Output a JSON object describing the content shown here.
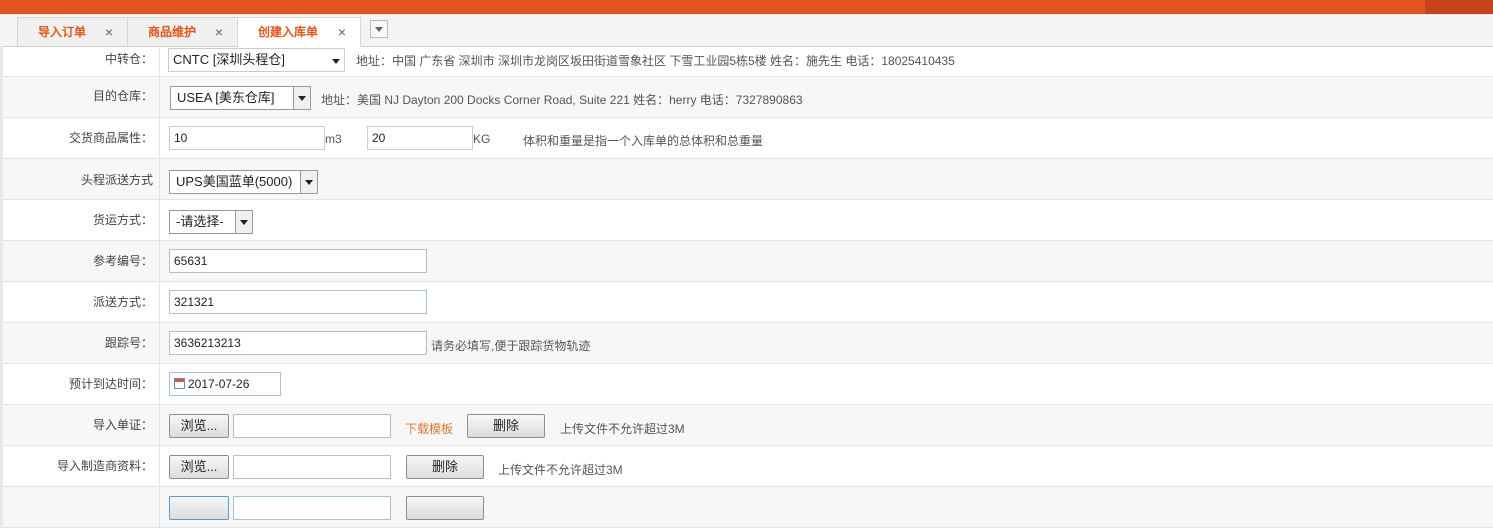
{
  "tabs": [
    {
      "label": "导入订单",
      "close": "×"
    },
    {
      "label": "商品维护",
      "close": "×"
    },
    {
      "label": "创建入库单",
      "close": "×"
    }
  ],
  "form": {
    "transit": {
      "label": "中转仓：",
      "value": "CNTC [深圳头程仓]",
      "address": "地址：中国 广东省 深圳市 深圳市龙岗区坂田街道雪象社区 下雪工业园5栋5楼 姓名：施先生 电话：18025410435"
    },
    "destination": {
      "label": "目的仓库：",
      "value": "USEA [美东仓库]",
      "address": "地址：美国 NJ Dayton 200 Docks Corner Road, Suite 221 姓名：herry 电话：7327890863"
    },
    "goods_attr": {
      "label": "交货商品属性：",
      "volume": "10",
      "volume_unit": "m3",
      "weight": "20",
      "weight_unit": "KG",
      "note": "体积和重量是指一个入库单的总体积和总重量"
    },
    "first_leg": {
      "label": "头程派送方式",
      "value": "UPS美国蓝单(5000)"
    },
    "freight": {
      "label": "货运方式：",
      "value": "-请选择-"
    },
    "reference": {
      "label": "参考编号：",
      "value": "65631"
    },
    "delivery": {
      "label": "派送方式：",
      "value": "321321"
    },
    "tracking": {
      "label": "跟踪号：",
      "value": "3636213213",
      "note": "请务必填写,便于跟踪货物轨迹"
    },
    "eta": {
      "label": "预计到达时间：",
      "value": "2017-07-26"
    },
    "import_doc": {
      "label": "导入单证：",
      "browse": "浏览...",
      "download": "下载模板",
      "delete": "删除",
      "note": "上传文件不允许超过3M"
    },
    "import_mfr": {
      "label": "导入制造商资料：",
      "browse": "浏览...",
      "delete": "删除",
      "note": "上传文件不允许超过3M"
    }
  }
}
